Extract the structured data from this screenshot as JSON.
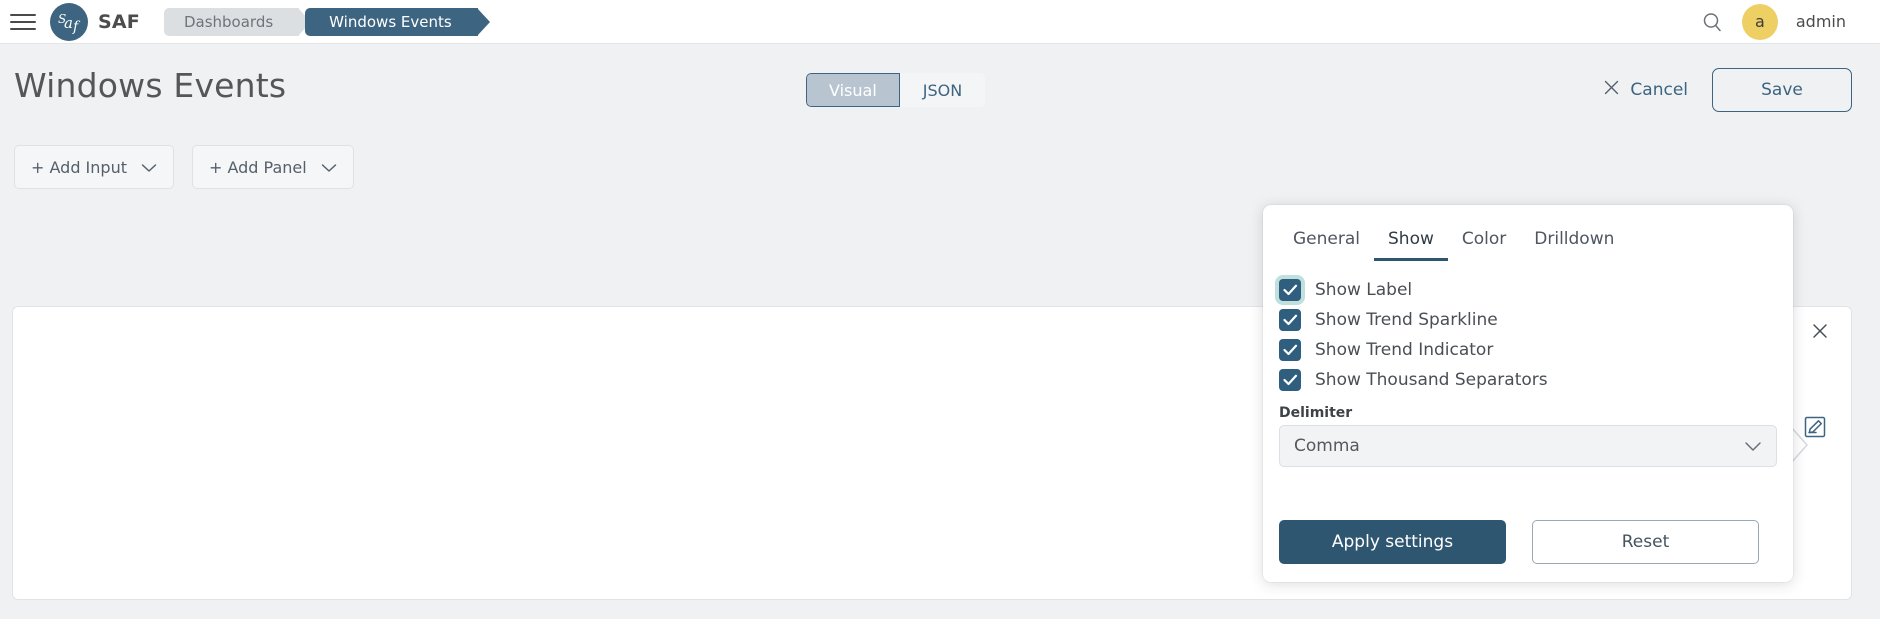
{
  "topbar": {
    "menu_icon": "hamburger-menu-icon",
    "logo_text": "SAF",
    "logo_mark": "saf-logo-icon",
    "breadcrumbs": [
      {
        "label": "Dashboards",
        "active": false
      },
      {
        "label": "Windows Events",
        "active": true
      }
    ],
    "search_icon": "search-icon",
    "avatar_initial": "a",
    "username": "admin"
  },
  "page": {
    "title": "Windows Events",
    "view_modes": [
      {
        "label": "Visual",
        "active": true
      },
      {
        "label": "JSON",
        "active": false
      }
    ],
    "cancel_label": "Cancel",
    "cancel_icon": "close-x-icon",
    "save_label": "Save"
  },
  "toolbar": {
    "buttons": [
      {
        "label": "+ Add Input",
        "icon": "chevron-down-icon"
      },
      {
        "label": "+ Add Panel",
        "icon": "chevron-down-icon"
      }
    ]
  },
  "panel": {
    "drag_icon": "drag-handle-icon",
    "close_icon": "close-x-icon",
    "edit_icon": "edit-pencil-square-icon"
  },
  "settings_popup": {
    "tabs": [
      {
        "label": "General",
        "active": false
      },
      {
        "label": "Show",
        "active": true
      },
      {
        "label": "Color",
        "active": false
      },
      {
        "label": "Drilldown",
        "active": false
      }
    ],
    "checkboxes": [
      {
        "label": "Show Label",
        "checked": true,
        "focused": true
      },
      {
        "label": "Show Trend Sparkline",
        "checked": true,
        "focused": false
      },
      {
        "label": "Show Trend Indicator",
        "checked": true,
        "focused": false
      },
      {
        "label": "Show Thousand Separators",
        "checked": true,
        "focused": false
      }
    ],
    "delimiter": {
      "label": "Delimiter",
      "value": "Comma",
      "icon": "chevron-down-icon"
    },
    "apply_label": "Apply settings",
    "reset_label": "Reset"
  },
  "colors": {
    "brand_slate": "#3d6480",
    "accent_dark": "#2f5670",
    "checkbox_blue": "#2f5e7e",
    "avatar_gold": "#edcf63",
    "page_bg": "#eff1f3",
    "focus_ring": "#bfe0dc"
  }
}
